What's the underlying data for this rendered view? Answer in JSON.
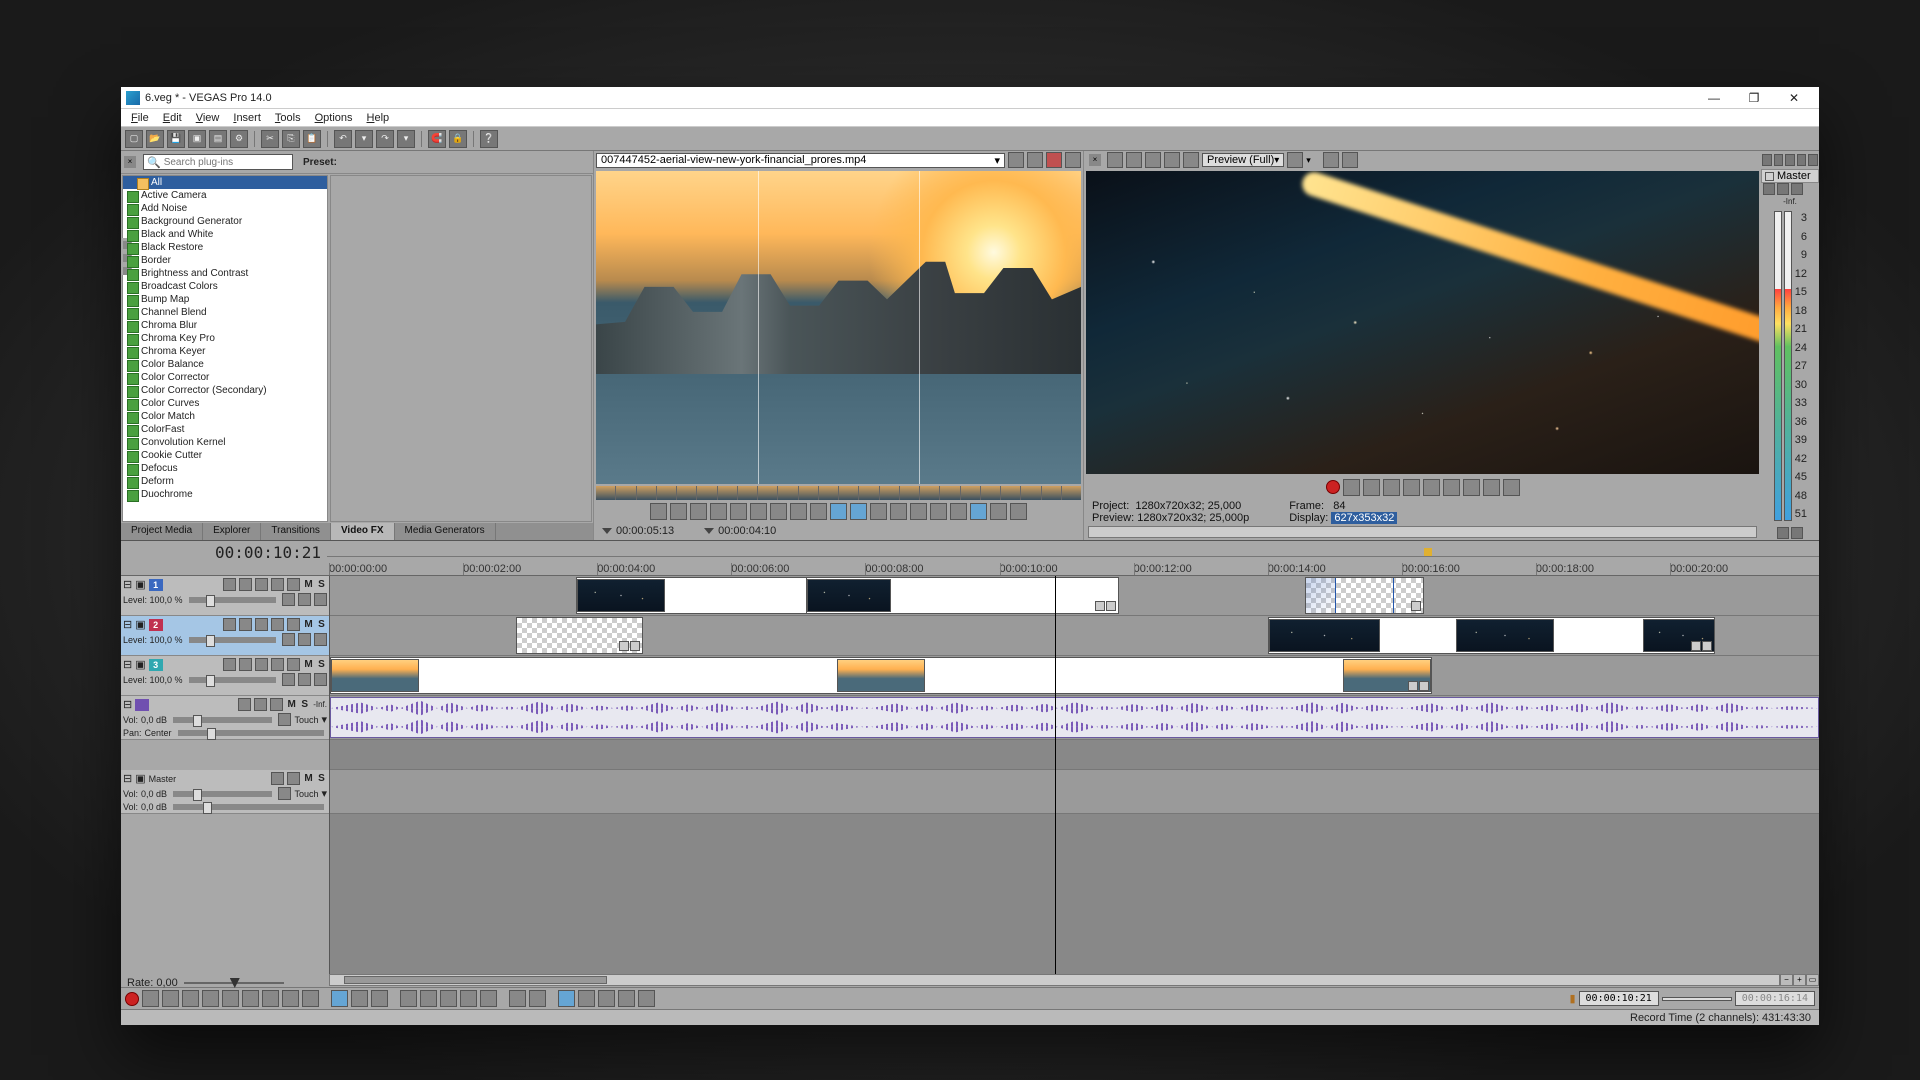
{
  "window": {
    "title": "6.veg * - VEGAS Pro 14.0"
  },
  "menu": [
    "File",
    "Edit",
    "View",
    "Insert",
    "Tools",
    "Options",
    "Help"
  ],
  "fx": {
    "search_placeholder": "Search plug-ins",
    "preset_label": "Preset:",
    "root": "All",
    "items": [
      "Active Camera",
      "Add Noise",
      "Background Generator",
      "Black and White",
      "Black Restore",
      "Border",
      "Brightness and Contrast",
      "Broadcast Colors",
      "Bump Map",
      "Channel Blend",
      "Chroma Blur",
      "Chroma Key Pro",
      "Chroma Keyer",
      "Color Balance",
      "Color Corrector",
      "Color Corrector (Secondary)",
      "Color Curves",
      "Color Match",
      "ColorFast",
      "Convolution Kernel",
      "Cookie Cutter",
      "Defocus",
      "Deform",
      "Duochrome"
    ],
    "tabs": [
      "Project Media",
      "Explorer",
      "Transitions",
      "Video FX",
      "Media Generators"
    ],
    "active_tab": "Video FX"
  },
  "trimmer": {
    "file": "007447452-aerial-view-new-york-financial_prores.mp4",
    "time_in": "00:00:05:13",
    "time_out": "00:00:04:10"
  },
  "preview": {
    "quality": "Preview (Full)",
    "project_label": "Project:",
    "project_value": "1280x720x32; 25,000",
    "preview_label": "Preview:",
    "preview_value": "1280x720x32; 25,000p",
    "frame_label": "Frame:",
    "frame_value": "84",
    "display_label": "Display:",
    "display_value": "627x353x32"
  },
  "master": {
    "label": "Master",
    "inf": "-Inf.",
    "scale": [
      "3",
      "6",
      "9",
      "12",
      "15",
      "18",
      "21",
      "24",
      "27",
      "30",
      "33",
      "36",
      "39",
      "42",
      "45",
      "48",
      "51"
    ]
  },
  "timeline": {
    "current": "00:00:10:21",
    "ruler": [
      "00:00:00:00",
      "00:00:02:00",
      "00:00:04:00",
      "00:00:06:00",
      "00:00:08:00",
      "00:00:10:00",
      "00:00:12:00",
      "00:00:14:00",
      "00:00:16:00",
      "00:00:18:00",
      "00:00:20:00"
    ],
    "tracks": [
      {
        "num": "1",
        "type": "v1",
        "level": "Level: 100,0 %",
        "m": "M",
        "s": "S"
      },
      {
        "num": "2",
        "type": "v2",
        "level": "Level: 100,0 %",
        "m": "M",
        "s": "S"
      },
      {
        "num": "3",
        "type": "v3",
        "level": "Level: 100,0 %",
        "m": "M",
        "s": "S"
      },
      {
        "num": "",
        "type": "a",
        "vol": "Vol:",
        "vol_val": "0,0 dB",
        "pan": "Pan:",
        "pan_val": "Center",
        "touch": "Touch",
        "m": "M",
        "s": "S",
        "inf": "-Inf."
      },
      {
        "num": "",
        "type": "m",
        "label": "Master",
        "vol": "Vol:",
        "vol_val": "0,0 dB",
        "touch": "Touch",
        "m": "M",
        "s": "S"
      }
    ]
  },
  "transport": {
    "rate_label": "Rate: 0,00",
    "tc1": "00:00:10:21",
    "tc2": "00:00:16:14"
  },
  "status": "Record Time (2 channels): 431:43:30"
}
